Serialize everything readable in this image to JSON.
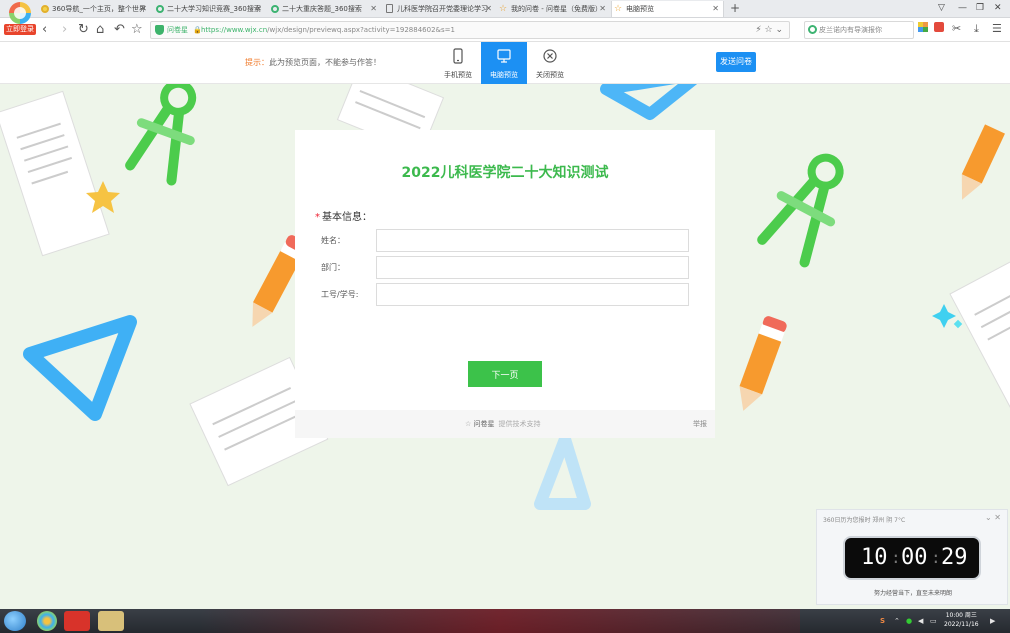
{
  "browser": {
    "login_label": "立即登录",
    "tabs": [
      {
        "title": "360导航_一个主页，整个世界",
        "icon": "circle-yellow"
      },
      {
        "title": "二十大学习知识竞赛_360搜索",
        "icon": "circle-green"
      },
      {
        "title": "二十大重庆答题_360搜索",
        "icon": "circle-green"
      },
      {
        "title": "儿科医学院召开党委理论学习",
        "icon": "doc"
      },
      {
        "title": "我的问卷 - 问卷星（免费版）",
        "icon": "star"
      },
      {
        "title": "电脑预览",
        "icon": "star",
        "active": true
      }
    ],
    "new_tab_label": "+",
    "address": {
      "site_badge": "问卷星",
      "url_host": "https://www.wjx.cn",
      "url_path": "/wjx/design/previewq.aspx?activity=192884602&s=1"
    },
    "search_placeholder": "皮兰诺内有导演报你",
    "window_controls": [
      "▽",
      "—",
      "❐",
      "✕"
    ]
  },
  "preview_bar": {
    "hint_prefix": "提示：",
    "hint_text": "此为预览页面，不能参与作答！",
    "modes": [
      {
        "label": "手机预览",
        "icon": "phone-icon",
        "active": false
      },
      {
        "label": "电脑预览",
        "icon": "monitor-icon",
        "active": true
      },
      {
        "label": "关闭预览",
        "icon": "close-circle-icon",
        "active": false
      }
    ],
    "send_label": "发送问卷"
  },
  "survey": {
    "title": "2022儿科医学院二十大知识测试",
    "section_label": "基本信息：",
    "required_mark": "*",
    "fields": [
      {
        "label": "姓名：",
        "value": ""
      },
      {
        "label": "部门：",
        "value": ""
      },
      {
        "label": "工号/学号:",
        "value": ""
      }
    ],
    "next_label": "下一页",
    "footer_brand": "问卷星",
    "footer_tech": "提供技术支持",
    "report_label": "举报"
  },
  "clock_widget": {
    "header": "360日历为您报时 郑州 阴 7°C",
    "hours": "10",
    "minutes": "00",
    "seconds": "29",
    "motto": "努力经营当下，直至未来明朗"
  },
  "taskbar": {
    "time": "10:00 周三",
    "date": "2022/11/16"
  },
  "colors": {
    "brand_green": "#3cb94d",
    "accent_blue": "#1c90f3",
    "button_green": "#3cc24a",
    "background": "#eef5ea"
  }
}
